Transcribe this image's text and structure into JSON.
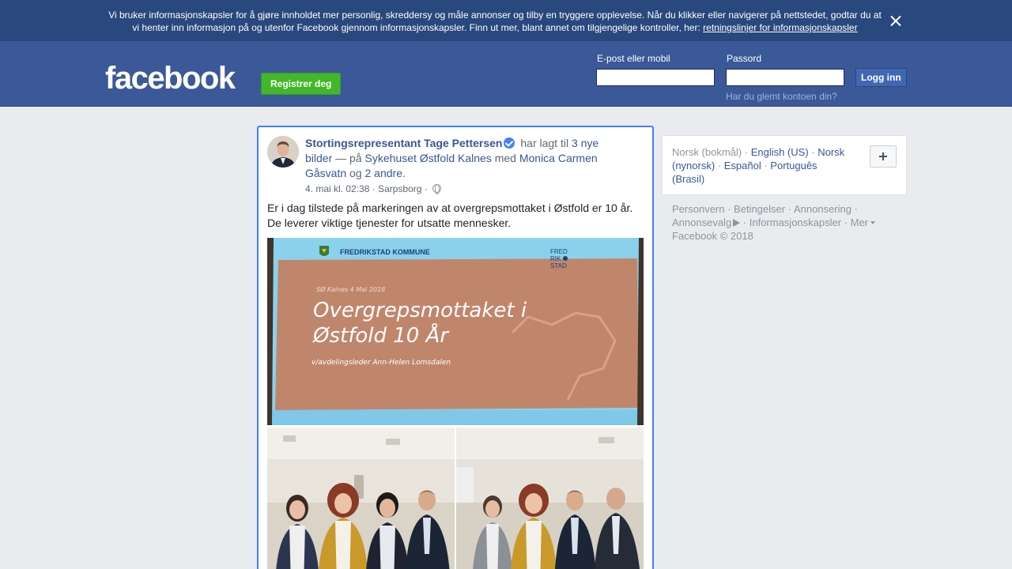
{
  "cookie_banner": {
    "text_line1": "Vi bruker informasjonskapsler for å gjøre innholdet mer personlig, skreddersy og måle annonser og tilby en tryggere opplevelse. Når du klikker eller navigerer på nettstedet, godtar du at",
    "text_line2": "vi henter inn informasjon på og utenfor Facebook gjennom informasjonskapsler. Finn ut mer, blant annet om tilgjengelige kontroller, her:",
    "link_text": "retningslinjer for informasjonskapsler",
    "close_icon": "close-icon"
  },
  "header": {
    "logo": "facebook",
    "register_label": "Registrer deg",
    "email_label": "E-post eller mobil",
    "email_value": "",
    "password_label": "Passord",
    "password_value": "",
    "login_label": "Logg inn",
    "forgot_label": "Har du glemt kontoen din?"
  },
  "post": {
    "author": "Stortingsrepresentant Tage Pettersen",
    "verified_icon": "verified-badge-icon",
    "action_text": "har lagt til",
    "photos_link": "3 nye bilder",
    "dash_text": "— på",
    "place_link": "Sykehuset Østfold Kalnes",
    "with_text": "med",
    "tagged_link": "Monica Carmen Gåsvatn",
    "and_text": "og",
    "others_link": "2 andre.",
    "timestamp": "4. mai kl. 02:38",
    "location": "Sarpsborg",
    "privacy_icon": "globe-icon",
    "text": "Er i dag tilstede på markeringen av at overgrepsmottaket i Østfold er 10 år. De leverer viktige tjenester for utsatte mennesker.",
    "slide": {
      "org": "FREDRIKSTAD KOMMUNE",
      "org_logo_line1": "FRED",
      "org_logo_line2": "RIK",
      "org_logo_line3": "STAD",
      "dateline": "SØ Kalnes 4 Mai 2018",
      "title_line1": "Overgrepsmottaket i",
      "title_line2": "Østfold 10 År",
      "subtitle": "v/avdelingsleder Ann-Helen Lomsdalen"
    }
  },
  "sidebar": {
    "current_language": "Norsk (bokmål)",
    "languages": [
      "English (US)",
      "Norsk (nynorsk)",
      "Español",
      "Português (Brasil)"
    ],
    "add_language_icon": "plus-icon",
    "footer_links": [
      "Personvern",
      "Betingelser",
      "Annonsering",
      "Annonsevalg",
      "Informasjonskapsler",
      "Mer"
    ],
    "adchoices_icon": "adchoices-icon",
    "copyright": "Facebook © 2018"
  },
  "colors": {
    "brand_blue": "#3b5998",
    "banner_blue": "#29487d",
    "register_green": "#42b72a",
    "link_blue": "#365899",
    "focus_blue": "#4080ff"
  }
}
